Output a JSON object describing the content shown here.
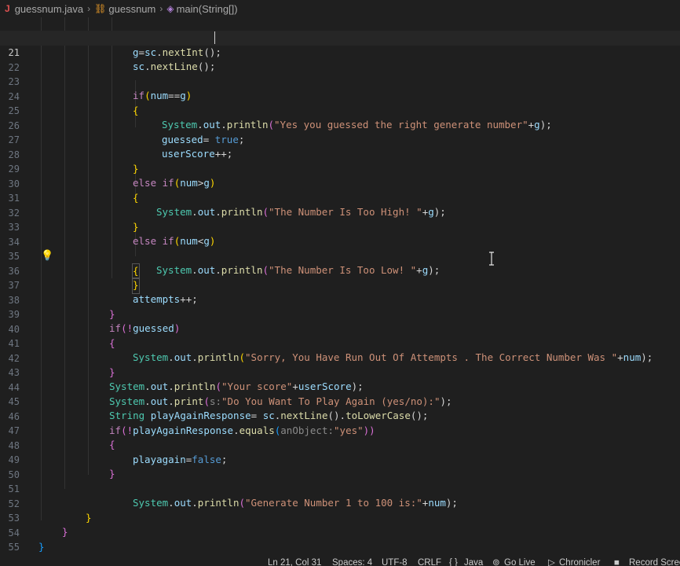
{
  "breadcrumb": {
    "file": "guessnum.java",
    "class": "guessnum",
    "method": "main(String[])"
  },
  "editor": {
    "current_line": "21",
    "line_numbers": [
      "21",
      "22",
      "23",
      "24",
      "25",
      "26",
      "27",
      "28",
      "29",
      "30",
      "31",
      "32",
      "33",
      "34",
      "35",
      "36",
      "37",
      "38",
      "39",
      "40",
      "41",
      "42",
      "43",
      "44",
      "45",
      "46",
      "47",
      "48",
      "49",
      "50",
      "51",
      "52",
      "53",
      "54",
      "55"
    ],
    "code": {
      "l20": [
        "g",
        "=",
        "sc",
        ".",
        "nextInt",
        "();"
      ],
      "l21": [
        "sc",
        ".",
        "nextLine",
        "();"
      ],
      "l23": [
        "if",
        "(",
        "num",
        "==",
        "g",
        ")"
      ],
      "l24": [
        "{"
      ],
      "l25": [
        "System",
        ".",
        "out",
        ".",
        "println",
        "(",
        "\"Yes you guessed the right generate number\"",
        "+",
        "g",
        ");"
      ],
      "l26": [
        "guessed",
        "= ",
        "true",
        ";"
      ],
      "l27": [
        "userScore",
        "++",
        ";"
      ],
      "l28": [
        "}"
      ],
      "l29": [
        "else",
        " ",
        "if",
        "(",
        "num",
        ">",
        "g",
        ")"
      ],
      "l30": [
        "{"
      ],
      "l31": [
        "System",
        ".",
        "out",
        ".",
        "println",
        "(",
        "\"The Number Is Too High! \"",
        "+",
        "g",
        ");"
      ],
      "l32": [
        "}"
      ],
      "l33": [
        "else",
        " ",
        "if",
        "(",
        "num",
        "<",
        "g",
        ")"
      ],
      "l34": [
        "{"
      ],
      "l35": [
        "System",
        ".",
        "out",
        ".",
        "println",
        "(",
        "\"The Number Is Too Low! \"",
        "+",
        "g",
        ");"
      ],
      "l36": [
        "}"
      ],
      "l37": [
        "attempts",
        "++",
        ";"
      ],
      "l38": [
        "}"
      ],
      "l39": [
        "if",
        "(!",
        "guessed",
        ")"
      ],
      "l40": [
        "{"
      ],
      "l41": [
        "System",
        ".",
        "out",
        ".",
        "println",
        "(",
        "\"Sorry, You Have Run Out Of Attempts . The Correct Number Was \"",
        "+",
        "num",
        ");"
      ],
      "l42": [
        "}"
      ],
      "l43": [
        "System",
        ".",
        "out",
        ".",
        "println",
        "(",
        "\"Your score\"",
        "+",
        "userScore",
        ");"
      ],
      "l44": [
        "System",
        ".",
        "out",
        ".",
        "print",
        "(",
        "s:",
        "\"Do You Want To Play Again (yes/no):\"",
        ");"
      ],
      "l45": [
        "String",
        " ",
        "playAgainResponse",
        "= ",
        "sc",
        ".",
        "nextLine",
        "().",
        "toLowerCase",
        "();"
      ],
      "l46": [
        "if",
        "(!",
        "playAgainResponse",
        ".",
        "equals",
        "(",
        "anObject:",
        "\"yes\"",
        "))"
      ],
      "l47": [
        "{"
      ],
      "l48": [
        "playagain",
        "=",
        "false",
        ";"
      ],
      "l49": [
        "}"
      ],
      "l51": [
        "System",
        ".",
        "out",
        ".",
        "println",
        "(",
        "\"Generate Number 1 to 100 is:\"",
        "+",
        "num",
        ");"
      ],
      "l52": [
        "}"
      ],
      "l53": [
        "}"
      ],
      "l54": [
        "}"
      ]
    }
  },
  "status_bar": {
    "position": "Ln 21, Col 31",
    "spaces": "Spaces: 4",
    "encoding": "UTF-8",
    "eol": "CRLF",
    "language": "Java",
    "go_live": "Go Live",
    "chronicler": "Chronicler",
    "record": "Record Screen"
  },
  "icons": {
    "java": "java-file-icon",
    "class": "class-icon",
    "method": "method-icon",
    "bulb": "lightbulb-icon",
    "broadcast": "broadcast-icon",
    "play": "play-icon",
    "record": "record-icon",
    "braces": "braces-icon"
  }
}
